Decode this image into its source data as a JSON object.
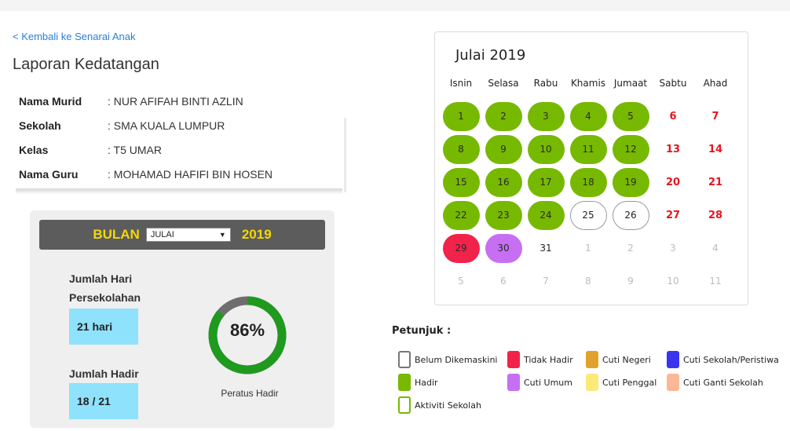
{
  "nav": {
    "back_link": "< Kembali ke Senarai Anak"
  },
  "page": {
    "title": "Laporan Kedatangan"
  },
  "student": {
    "rows": [
      {
        "label": "Nama Murid",
        "value": ": NUR AFIFAH BINTI AZLIN"
      },
      {
        "label": "Sekolah",
        "value": ": SMA KUALA LUMPUR"
      },
      {
        "label": "Kelas",
        "value": ": T5 UMAR"
      },
      {
        "label": "Nama Guru",
        "value": ": MOHAMAD HAFIFI BIN HOSEN"
      }
    ]
  },
  "summary": {
    "month_label": "BULAN",
    "month_selected": "JULAI",
    "year": "2019",
    "school_days_label_1": "Jumlah Hari",
    "school_days_label_2": "Persekolahan",
    "school_days_value": "21 hari",
    "attended_label": "Jumlah Hadir",
    "attended_value": "18 / 21",
    "percent_text": "86%",
    "percent_value": 0.86,
    "percent_caption": "Peratus Hadir",
    "colors": {
      "ring": "#1f9a1f",
      "ring_rest": "#6e6e6e",
      "yellow": "#f5d800",
      "box": "#8fe2fb"
    }
  },
  "calendar": {
    "title": "Julai 2019",
    "weekdays": [
      "Isnin",
      "Selasa",
      "Rabu",
      "Khamis",
      "Jumaat",
      "Sabtu",
      "Ahad"
    ],
    "weeks": [
      [
        {
          "d": "1",
          "s": "hadir"
        },
        {
          "d": "2",
          "s": "hadir"
        },
        {
          "d": "3",
          "s": "hadir"
        },
        {
          "d": "4",
          "s": "hadir"
        },
        {
          "d": "5",
          "s": "hadir"
        },
        {
          "d": "6",
          "s": "weekend"
        },
        {
          "d": "7",
          "s": "weekend"
        }
      ],
      [
        {
          "d": "8",
          "s": "hadir"
        },
        {
          "d": "9",
          "s": "hadir"
        },
        {
          "d": "10",
          "s": "hadir"
        },
        {
          "d": "11",
          "s": "hadir"
        },
        {
          "d": "12",
          "s": "hadir"
        },
        {
          "d": "13",
          "s": "weekend"
        },
        {
          "d": "14",
          "s": "weekend"
        }
      ],
      [
        {
          "d": "15",
          "s": "hadir"
        },
        {
          "d": "16",
          "s": "hadir"
        },
        {
          "d": "17",
          "s": "hadir"
        },
        {
          "d": "18",
          "s": "hadir"
        },
        {
          "d": "19",
          "s": "hadir"
        },
        {
          "d": "20",
          "s": "weekend"
        },
        {
          "d": "21",
          "s": "weekend"
        }
      ],
      [
        {
          "d": "22",
          "s": "hadir"
        },
        {
          "d": "23",
          "s": "hadir"
        },
        {
          "d": "24",
          "s": "hadir"
        },
        {
          "d": "25",
          "s": "belum"
        },
        {
          "d": "26",
          "s": "belum"
        },
        {
          "d": "27",
          "s": "weekend"
        },
        {
          "d": "28",
          "s": "weekend"
        }
      ],
      [
        {
          "d": "29",
          "s": "tidak"
        },
        {
          "d": "30",
          "s": "umum"
        },
        {
          "d": "31",
          "s": "plain"
        },
        {
          "d": "1",
          "s": "muted"
        },
        {
          "d": "2",
          "s": "muted"
        },
        {
          "d": "3",
          "s": "muted"
        },
        {
          "d": "4",
          "s": "muted"
        }
      ],
      [
        {
          "d": "5",
          "s": "muted"
        },
        {
          "d": "6",
          "s": "muted"
        },
        {
          "d": "7",
          "s": "muted"
        },
        {
          "d": "8",
          "s": "muted"
        },
        {
          "d": "9",
          "s": "muted"
        },
        {
          "d": "10",
          "s": "muted"
        },
        {
          "d": "11",
          "s": "muted"
        }
      ]
    ]
  },
  "legend": {
    "title": "Petunjuk :",
    "items": [
      {
        "label": "Belum Dikemaskini",
        "color": "#ffffff",
        "border": "#777777"
      },
      {
        "label": "Tidak Hadir",
        "color": "#f2234a"
      },
      {
        "label": "Cuti Negeri",
        "color": "#e0a22a"
      },
      {
        "label": "Cuti Sekolah/Peristiwa",
        "color": "#3a34ee"
      },
      {
        "label": "Hadir",
        "color": "#76b900"
      },
      {
        "label": "Cuti Umum",
        "color": "#c76ff2"
      },
      {
        "label": "Cuti Penggal",
        "color": "#fbe97a"
      },
      {
        "label": "Cuti Ganti Sekolah",
        "color": "#fbb896"
      },
      {
        "label": "Aktiviti Sekolah",
        "color": "#ffffff",
        "border": "#76b900"
      }
    ]
  }
}
